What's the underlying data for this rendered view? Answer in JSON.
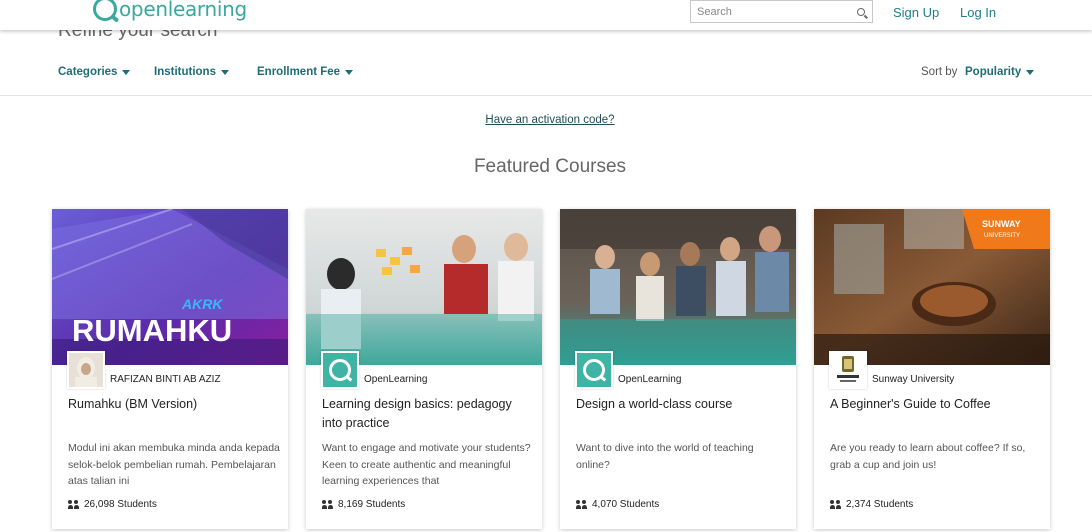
{
  "header": {
    "logo_text": "openlearning",
    "search_placeholder": "Search",
    "signup_label": "Sign Up",
    "login_label": "Log In"
  },
  "refine": {
    "title": "Refine your search"
  },
  "filters": {
    "categories": "Categories",
    "institutions": "Institutions",
    "enrollment_fee": "Enrollment Fee",
    "sort_label": "Sort by",
    "sort_value": "Popularity"
  },
  "activation_link": "Have an activation code?",
  "featured_title": "Featured Courses",
  "courses": [
    {
      "institution": "RAFIZAN BINTI AB AZIZ",
      "title": "Rumahku (BM Version)",
      "description": "Modul ini akan membuka minda anda kepada selok-belok pembelian rumah. Pembelajaran atas talian ini",
      "students": "26,098 Students",
      "image_text": "RUMAHKU",
      "image_logo": "AKRK"
    },
    {
      "institution": "OpenLearning",
      "title": "Learning design basics: pedagogy into practice",
      "description": "Want to engage and motivate your students? Keen to create authentic and meaningful learning experiences that",
      "students": "8,169 Students"
    },
    {
      "institution": "OpenLearning",
      "title": "Design a world-class course",
      "description": "Want to dive into the world of teaching online?",
      "students": "4,070 Students"
    },
    {
      "institution": "Sunway University",
      "title": "A Beginner's Guide to Coffee",
      "description": "Are you ready to learn about coffee? If so, grab a cup and join us!",
      "students": "2,374 Students",
      "badge_text_1": "SUNWAY",
      "badge_text_2": "UNIVERSITY"
    }
  ],
  "colors": {
    "brand_teal": "#3aa89e",
    "link_teal": "#1f6d74"
  }
}
